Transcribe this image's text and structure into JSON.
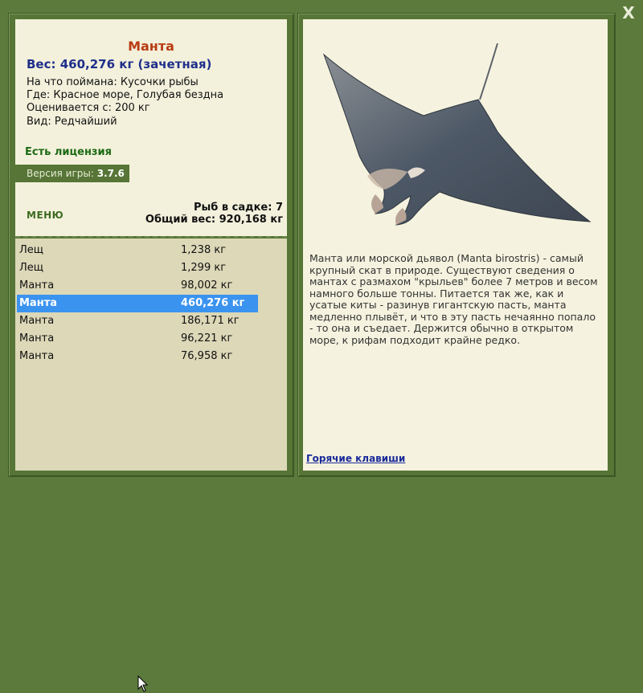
{
  "fish": {
    "name": "Манта",
    "weight_line": "Вес: 460,276 кг (зачетная)",
    "caught_on": "На что поймана: Кусочки рыбы",
    "where": "Где: Красное море, Голубая бездна",
    "price": "Оценивается с: 200 кг",
    "kind": "Вид: Редчайший",
    "description": "Манта или морской дьявол (Manta birostris) - самый крупный скат в природе. Существуют сведения о мантах с размахом \"крыльев\" более 7 метров и весом намного больше тонны. Питается так же, как и усатые киты - разинув гигантскую пасть, манта медленно плывёт, и что в эту пасть нечаянно попало - то она и съедает. Держится обычно в открытом море, к рифам подходит крайне редко."
  },
  "license": "Есть лицензия",
  "version": {
    "label": "Версия игры:",
    "value": "3.7.6"
  },
  "menu_label": "МЕНЮ",
  "cage": {
    "count_line": "Рыб в садке: 7",
    "total_line": "Общий вес: 920,168 кг"
  },
  "catch_list": [
    {
      "name": "Лещ",
      "weight": "1,238 кг",
      "selected": false
    },
    {
      "name": "Лещ",
      "weight": "1,299 кг",
      "selected": false
    },
    {
      "name": "Манта",
      "weight": "98,002 кг",
      "selected": false
    },
    {
      "name": "Манта",
      "weight": "460,276 кг",
      "selected": true
    },
    {
      "name": "Манта",
      "weight": "186,171 кг",
      "selected": false
    },
    {
      "name": "Манта",
      "weight": "96,221 кг",
      "selected": false
    },
    {
      "name": "Манта",
      "weight": "76,958 кг",
      "selected": false
    }
  ],
  "hotkeys_label": "Горячие клавиши",
  "close_label": "X",
  "icons": [
    "close-icon",
    "manta-ray-image",
    "mouse-cursor-icon"
  ],
  "colors": {
    "frame_green": "#567536",
    "title_orange": "#b83c12",
    "weight_blue": "#1f2f8a",
    "license_green": "#1e6a14",
    "selection_blue": "#3b93f0",
    "link_blue": "#1a2a9a"
  }
}
